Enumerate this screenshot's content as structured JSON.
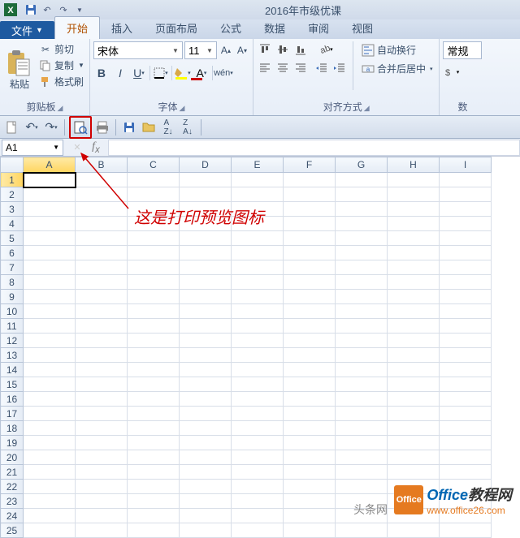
{
  "window": {
    "title": "2016年市级优课"
  },
  "tabs": {
    "file": "文件",
    "items": [
      "开始",
      "插入",
      "页面布局",
      "公式",
      "数据",
      "审阅",
      "视图"
    ],
    "activeIndex": 0
  },
  "ribbon": {
    "clipboard": {
      "paste": "粘贴",
      "cut": "剪切",
      "copy": "复制",
      "formatPainter": "格式刷",
      "label": "剪贴板"
    },
    "font": {
      "name": "宋体",
      "size": "11",
      "label": "字体"
    },
    "alignment": {
      "wrap": "自动换行",
      "merge": "合并后居中",
      "label": "对齐方式"
    },
    "number": {
      "format": "常规",
      "label": "数"
    }
  },
  "nameBox": "A1",
  "columns": [
    "A",
    "B",
    "C",
    "D",
    "E",
    "F",
    "G",
    "H",
    "I"
  ],
  "rows": [
    "1",
    "2",
    "3",
    "4",
    "5",
    "6",
    "7",
    "8",
    "9",
    "10",
    "11",
    "12",
    "13",
    "14",
    "15",
    "16",
    "17",
    "18",
    "19",
    "20",
    "21",
    "22",
    "23",
    "24",
    "25"
  ],
  "annotation": "这是打印预览图标",
  "watermark": {
    "logo": "Office",
    "brand1": "Office",
    "brand2": "教程网",
    "url": "www.office26.com",
    "source": "头条网"
  }
}
